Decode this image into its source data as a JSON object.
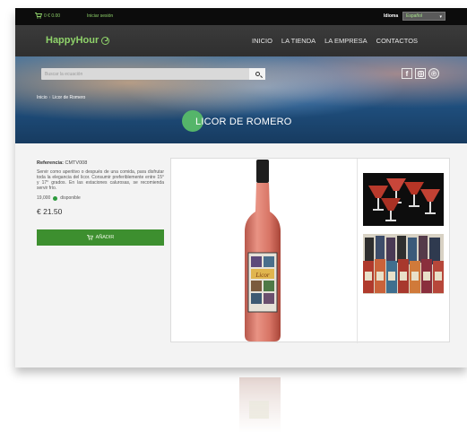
{
  "topbar": {
    "cart_text": "0 € 0.00",
    "login": "Iniciar sesión",
    "lang_label": "Idioma",
    "lang_value": "Español"
  },
  "nav": {
    "logo": "HappyHour",
    "items": [
      "INICIO",
      "LA TIENDA",
      "LA EMPRESA",
      "CONTACTOS"
    ]
  },
  "hero": {
    "search_placeholder": "Buscar la ecuación",
    "breadcrumb": [
      "Inicio",
      "Licor de Romero"
    ],
    "title": "LICOR DE ROMERO"
  },
  "product": {
    "ref_label": "Referencia:",
    "ref_value": "CMTV008",
    "description": "Servir como aperitivo o después de una comida, para disfrutar toda la elegancia del licor. Consumir preferiblemente entre 15° y 17° grados. En las estaciones calurosas, se recomienda servir frío.",
    "stock_qty": "19,000",
    "stock_status": "disponible",
    "price": "€ 21.50",
    "add_button": "AÑADIR",
    "bottle_label": "Licor"
  },
  "colors": {
    "accent_green": "#8fd26a",
    "button_green": "#3d8f2f",
    "nav_bg": "#333333"
  }
}
